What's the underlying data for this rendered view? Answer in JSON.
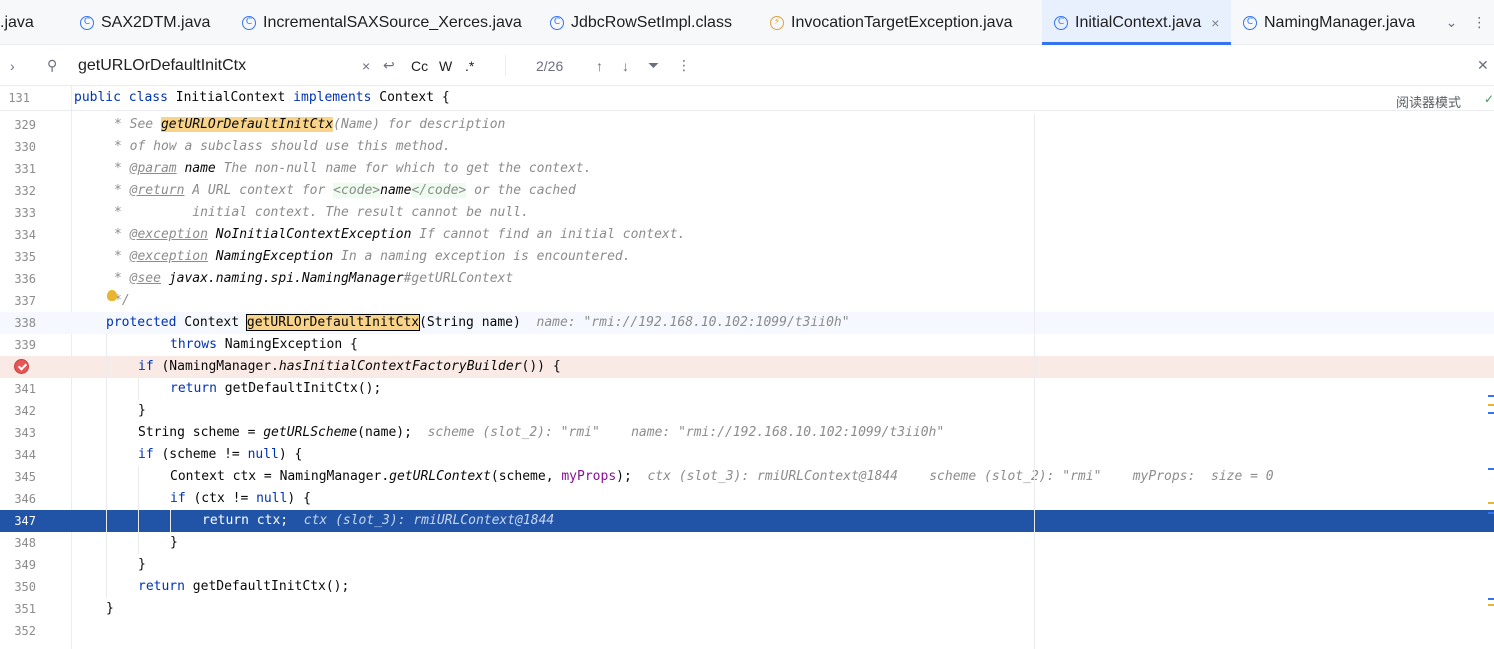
{
  "tabs": [
    {
      "label": ".java",
      "icon": "none"
    },
    {
      "label": "SAX2DTM.java",
      "icon": "class-icon"
    },
    {
      "label": "IncrementalSAXSource_Xerces.java",
      "icon": "class-icon"
    },
    {
      "label": "JdbcRowSetImpl.class",
      "icon": "class-icon"
    },
    {
      "label": "InvocationTargetException.java",
      "icon": "exception-icon"
    },
    {
      "label": "InitialContext.java",
      "icon": "class-icon",
      "active": true
    },
    {
      "label": "NamingManager.java",
      "icon": "class-icon"
    }
  ],
  "search": {
    "query": "getURLOrDefaultInitCtx",
    "count": "2/26",
    "options": {
      "case": "Cc",
      "word": "W",
      "regex": ".*"
    }
  },
  "sticky": {
    "line_number": "131",
    "kw1": "public",
    "kw2": "class",
    "name": "InitialContext",
    "kw3": "implements",
    "iface": "Context {"
  },
  "reader_mode": "阅读器模式",
  "lines": [
    {
      "n": "329"
    },
    {
      "n": "330"
    },
    {
      "n": "331"
    },
    {
      "n": "332"
    },
    {
      "n": "333"
    },
    {
      "n": "334"
    },
    {
      "n": "335"
    },
    {
      "n": "336"
    },
    {
      "n": "337"
    },
    {
      "n": "338"
    },
    {
      "n": "339"
    },
    {
      "n": "340"
    },
    {
      "n": "341"
    },
    {
      "n": "342"
    },
    {
      "n": "343"
    },
    {
      "n": "344"
    },
    {
      "n": "345"
    },
    {
      "n": "346"
    },
    {
      "n": "347"
    },
    {
      "n": "348"
    },
    {
      "n": "349"
    },
    {
      "n": "350"
    },
    {
      "n": "351"
    },
    {
      "n": "352"
    }
  ],
  "code": {
    "l329": {
      "a": "* See ",
      "m": "getURLOrDefaultInitCtx",
      "b": "(Name) for description"
    },
    "l330": "* of how a subclass should use this method.",
    "l331": {
      "a": "* ",
      "tag": "@param",
      "ref": "name",
      "b": " The non-null name for which to get the context."
    },
    "l332": {
      "a": "* ",
      "tag": "@return",
      "b": " A URL context for ",
      "t1": "<code>",
      "ref": "name",
      "t2": "</code>",
      "c": " or the cached"
    },
    "l333": "*         initial context. The result cannot be null.",
    "l334": {
      "a": "* ",
      "tag": "@exception",
      "ref": "NoInitialContextException",
      "b": " If cannot find an initial context."
    },
    "l335": {
      "a": "* ",
      "tag": "@exception",
      "ref": "NamingException",
      "b": " In a naming exception is encountered."
    },
    "l336": {
      "a": "* ",
      "tag": "@see",
      "ref": "javax.naming.spi.NamingManager",
      "b": "#getURLContext"
    },
    "l337": "*/",
    "l338": {
      "kw": "protected",
      "t": " Context ",
      "m": "getURLOrDefaultInitCtx",
      "b": "(String name)",
      "hint": "name: \"rmi://192.168.10.102:1099/t3ii0h\""
    },
    "l339": {
      "kw": "throws",
      "b": " NamingException {"
    },
    "l340": {
      "kw": "if",
      "a": " (NamingManager.",
      "it": "hasInitialContextFactoryBuilder",
      "b": "()) {"
    },
    "l341": {
      "kw": "return",
      "b": " getDefaultInitCtx();"
    },
    "l342": "}",
    "l343": {
      "a": "String scheme = ",
      "it": "getURLScheme",
      "b": "(name);",
      "hint": "scheme (slot_2): \"rmi\"    name: \"rmi://192.168.10.102:1099/t3ii0h\""
    },
    "l344": {
      "kw": "if",
      "a": " (scheme != ",
      "kw2": "null",
      "b": ") {"
    },
    "l345": {
      "a": "Context ctx = NamingManager.",
      "it": "getURLContext",
      "b": "(scheme, ",
      "field": "myProps",
      "c": ");",
      "hint": "ctx (slot_3): rmiURLContext@1844    scheme (slot_2): \"rmi\"    myProps:  size = 0"
    },
    "l346": {
      "kw": "if",
      "a": " (ctx != ",
      "kw2": "null",
      "b": ") {"
    },
    "l347": {
      "kw": "return",
      "b": " ctx;",
      "hint": "ctx (slot_3): rmiURLContext@1844"
    },
    "l348": "}",
    "l349": "}",
    "l350": {
      "kw": "return",
      "b": " getDefaultInitCtx();"
    },
    "l351": "}",
    "l352": ""
  }
}
